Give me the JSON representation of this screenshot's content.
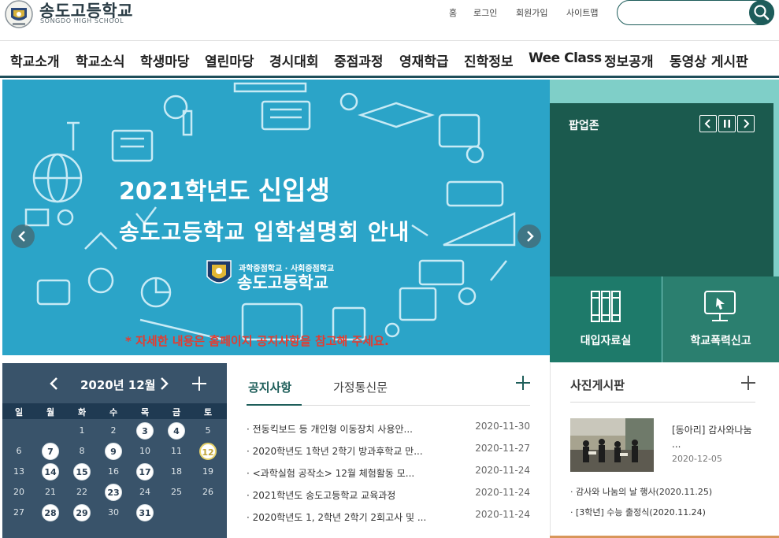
{
  "header": {
    "school_name": "송도고등학교",
    "school_name_en": "SONGDO HIGH SCHOOL",
    "util_links": [
      "홈",
      "로그인",
      "회원가입",
      "사이트맵"
    ],
    "search_placeholder": ""
  },
  "nav": {
    "items": [
      "학교소개",
      "학교소식",
      "학생마당",
      "열린마당",
      "경시대회",
      "중점과정",
      "영재학급",
      "진학정보",
      "Wee Class",
      "정보공개",
      "동영상 게시판"
    ]
  },
  "slider": {
    "line1_a": "2021학년도",
    "line1_b": "신입생",
    "line2": "송도고등학교 입학설명회 안내",
    "school_sub": "과학중점학교 · 사회중점학교",
    "school": "송도고등학교",
    "note": "* 자세한 내용은 홈페이지 공지사항을 참고해 주세요."
  },
  "popup": {
    "title": "팝업존"
  },
  "quick": {
    "items": [
      "대입자료실",
      "학교폭력신고"
    ]
  },
  "calendar": {
    "title": "2020년 12월",
    "weekdays": [
      "일",
      "월",
      "화",
      "수",
      "목",
      "금",
      "토"
    ],
    "weeks": [
      [
        "",
        "",
        "1",
        "2",
        "3",
        "4",
        "5"
      ],
      [
        "6",
        "7",
        "8",
        "9",
        "10",
        "11",
        "12"
      ],
      [
        "13",
        "14",
        "15",
        "16",
        "17",
        "18",
        "19"
      ],
      [
        "20",
        "21",
        "22",
        "23",
        "24",
        "25",
        "26"
      ],
      [
        "27",
        "28",
        "29",
        "30",
        "31",
        "",
        ""
      ]
    ],
    "event_days": [
      "3",
      "4",
      "7",
      "9",
      "14",
      "15",
      "17",
      "23",
      "28",
      "29",
      "31"
    ],
    "today": "12"
  },
  "notice": {
    "tab_active": "공지사항",
    "tab_other": "가정통신문",
    "items": [
      {
        "title": "· 전동킥보드 등 개인형 이동장치 사용안...",
        "date": "2020-11-30"
      },
      {
        "title": "· 2020학년도 1학년 2학기 방과후학교 만...",
        "date": "2020-11-27"
      },
      {
        "title": "· <과학실험 공작소> 12월 체험활동 모...",
        "date": "2020-11-24"
      },
      {
        "title": "· 2021학년도 송도고등학교 교육과정",
        "date": "2020-11-24"
      },
      {
        "title": "· 2020학년도 1, 2학년 2학기 2회고사 및 ...",
        "date": "2020-11-24"
      }
    ]
  },
  "photo": {
    "title": "사진게시판",
    "caption": "[동아리] 감사와나눔 ...",
    "caption_date": "2020-12-05",
    "items": [
      "· 감사와 나눔의 날 행사(2020.11.25)",
      "· [3학년] 수능 출정식(2020.11.24)"
    ]
  },
  "colors": {
    "primary": "#1d5c5a",
    "slider_bg": "#2ba4c8",
    "popup_bg": "#1b5a4e",
    "calendar_bg": "#39536a",
    "accent_red": "#e53b2f"
  }
}
